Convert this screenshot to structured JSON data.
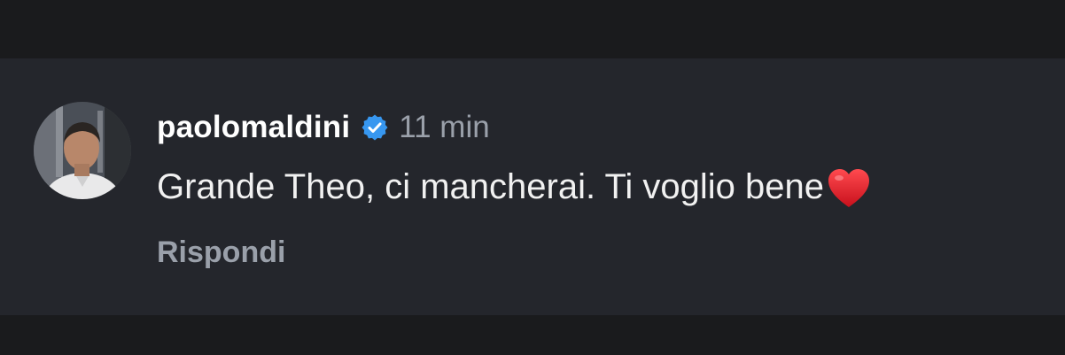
{
  "comment": {
    "username": "paolomaldini",
    "timestamp": "11 min",
    "text": "Grande Theo, ci mancherai. Ti voglio bene",
    "emoji": "heart-emoji",
    "reply_label": "Rispondi",
    "verified": true
  },
  "colors": {
    "background": "#1a1b1d",
    "card": "#24262c",
    "verified_badge": "#3797f0",
    "heart": "#e0202a",
    "muted_text": "#9aa0aa"
  },
  "icons": {
    "verified": "verified-badge-icon",
    "heart": "red-heart-emoji"
  }
}
